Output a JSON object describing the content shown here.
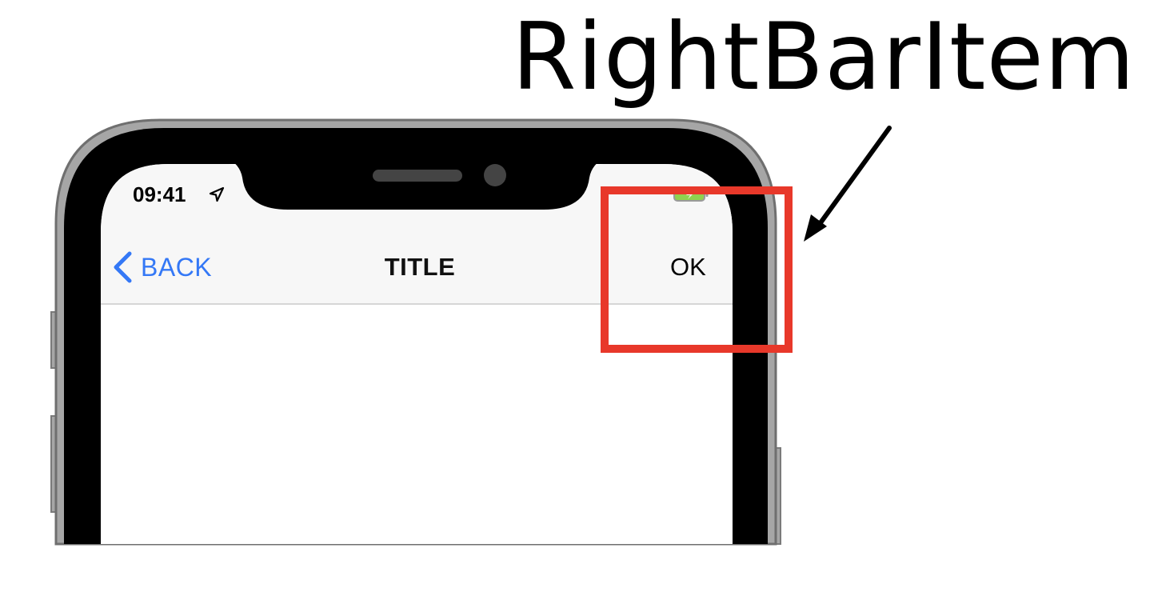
{
  "callout": {
    "label": "RightBarItem",
    "arrow_icon": "arrow-icon"
  },
  "status_bar": {
    "time": "09:41",
    "location_icon": "location-arrow-icon",
    "battery_icon": "battery-icon"
  },
  "navigation_bar": {
    "back_label": "BACK",
    "back_icon": "chevron-left-icon",
    "title": "TITLE",
    "right_item_label": "OK"
  },
  "colors": {
    "accent": "#3478f6",
    "highlight": "#e8382a",
    "nav_background": "#f7f7f7",
    "bezel": "#000000",
    "frame": "#a6a6a6"
  }
}
